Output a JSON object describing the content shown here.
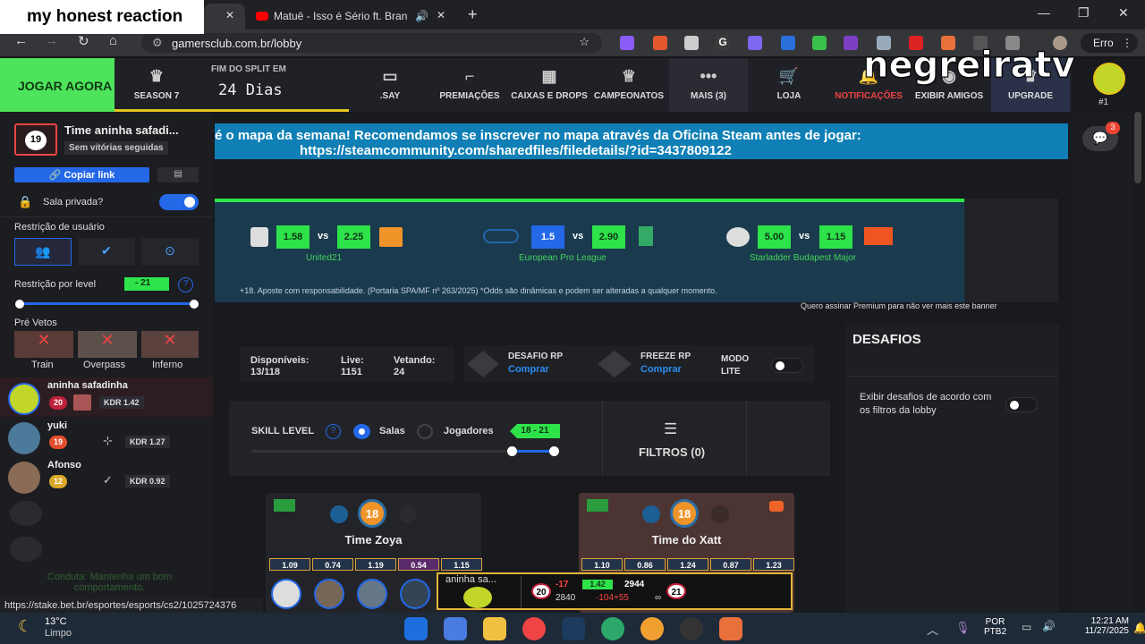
{
  "overlay_caption": "my honest reaction",
  "watermark": "negreiratv",
  "browser": {
    "tabs": [
      {
        "title": ""
      },
      {
        "title": "Matuê - Isso é Sério ft. Bran"
      }
    ],
    "url": "gamersclub.com.br/lobby",
    "profile_label": "Erro",
    "status_url": "https://stake.bet.br/esportes/esports/cs2/1025724376"
  },
  "topnav": {
    "play": "JOGAR AGORA",
    "season": "SEASON 7",
    "split_label": "FIM DO SPLIT EM",
    "split_days": "24 Dias",
    "items": [
      ".SAY",
      "PREMIAÇÕES",
      "CAIXAS E DROPS",
      "CAMPEONATOS",
      "MAIS (3)",
      "LOJA",
      "NOTIFICAÇÕES",
      "EXIBIR AMIGOS",
      "UPGRADE"
    ],
    "rank_hint": "#1"
  },
  "sidebar": {
    "team_level": "19",
    "team_name": "Time aninha safadi...",
    "team_streak": "Sem vitórias seguidas",
    "copy_link": "Copiar link",
    "private_room": "Sala privada?",
    "user_restriction": "Restrição de usuário",
    "level_restriction": "Restrição por level",
    "level_range": "- 21",
    "pre_vetos": "Pré Vetos",
    "maps": [
      "Train",
      "Overpass",
      "Inferno"
    ],
    "players": [
      {
        "name": "aninha safadinha",
        "level": "20",
        "kdr": "KDR 1.42"
      },
      {
        "name": "yuki",
        "level": "19",
        "kdr": "KDR 1.27"
      },
      {
        "name": "Afonso",
        "level": "12",
        "kdr": "KDR 0.92"
      }
    ],
    "conduct": "Conduta: Mantenha um bom comportamento."
  },
  "banner": {
    "line1": "é o mapa da semana! Recomendamos se inscrever no mapa através da Oficina Steam antes de jogar:",
    "line2": "https://steamcommunity.com/sharedfiles/filedetails/?id=3437809122"
  },
  "odds": {
    "matches": [
      {
        "odd1": "1.58",
        "odd2": "2.25",
        "league": "United21"
      },
      {
        "odd1": "1.5",
        "odd2": "2.90",
        "league": "European Pro League"
      },
      {
        "odd1": "5.00",
        "odd2": "1.15",
        "league": "Starladder Budapest Major"
      }
    ],
    "vs": "vs",
    "terms": "+18. Aposte com responsabilidade. (Portaria SPA/MF nº 263/2025) *Odds são dinâmicas e podem ser alteradas a qualquer momento.",
    "premium": "Quero assinar Premium para não ver mais este banner"
  },
  "stats": {
    "available_label": "Disponíveis:",
    "available": "13/118",
    "live_label": "Live:",
    "live": "1151",
    "veto_label": "Vetando:",
    "veto": "24",
    "desafio_rp": "DESAFIO RP",
    "freeze_rp": "FREEZE RP",
    "buy": "Comprar",
    "modo_lite": "MODO LITE"
  },
  "desafios": {
    "title": "DESAFIOS",
    "text": "Exibir desafios de acordo com os filtros da lobby"
  },
  "skill": {
    "label": "SKILL LEVEL",
    "rooms": "Salas",
    "players": "Jogadores",
    "range": "18 - 21",
    "filters": "FILTROS (0)"
  },
  "lobbies": [
    {
      "level": "18",
      "name": "Time Zoya",
      "kdrs": [
        "1.09",
        "0.74",
        "1.19",
        "0.54",
        "1.15"
      ]
    },
    {
      "level": "18",
      "name": "Time do Xatt",
      "kdrs": [
        "1.10",
        "0.86",
        "1.24",
        "0.87",
        "1.23"
      ]
    }
  ],
  "match_overlay": {
    "name": "aninha sa...",
    "lvl_left": "20",
    "lvl_right": "21",
    "delta": "-17",
    "kdr": "1.42",
    "rating": "2944",
    "rating2": "2840",
    "change": "-104+55",
    "infinity": "∞"
  },
  "taskbar": {
    "temp": "13°C",
    "weather": "Limpo",
    "lang": "POR",
    "layout": "PTB2",
    "time": "12:21 AM",
    "date": "11/27/2025"
  },
  "chat_badge": "3",
  "colors": {
    "accent_green": "#2ee24a",
    "banner_blue": "#0f7fb5",
    "level_orange": "#f0942a"
  }
}
